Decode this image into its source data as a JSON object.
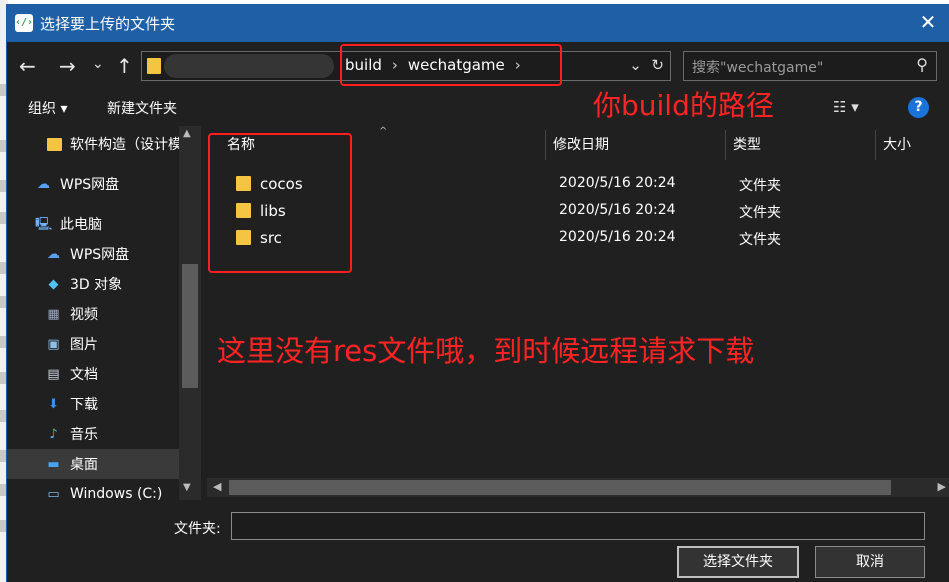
{
  "window": {
    "title": "选择要上传的文件夹",
    "close_glyph": "✕"
  },
  "nav": {
    "back_glyph": "←",
    "forward_glyph": "→",
    "recent_glyph": "⌄",
    "up_glyph": "↑"
  },
  "address": {
    "crumbs": [
      "build",
      "wechatgame"
    ],
    "sep": "›",
    "dropdown_glyph": "⌄",
    "refresh_glyph": "↻"
  },
  "search": {
    "placeholder": "搜索\"wechatgame\"",
    "icon": "search-icon"
  },
  "toolbar": {
    "organize": "组织 ▾",
    "new_folder": "新建文件夹",
    "view_glyph": "☷ ▾",
    "help_glyph": "?"
  },
  "sidebar": {
    "items": [
      {
        "label": "软件构造（设计模",
        "icon": "folder-icon"
      },
      {
        "label": "WPS网盘",
        "icon": "cloud-icon"
      },
      {
        "label": "此电脑",
        "icon": "computer-icon"
      },
      {
        "label": "WPS网盘",
        "icon": "cloud-icon"
      },
      {
        "label": "3D 对象",
        "icon": "cube-icon"
      },
      {
        "label": "视频",
        "icon": "video-icon"
      },
      {
        "label": "图片",
        "icon": "picture-icon"
      },
      {
        "label": "文档",
        "icon": "document-icon"
      },
      {
        "label": "下载",
        "icon": "download-icon"
      },
      {
        "label": "音乐",
        "icon": "music-icon"
      },
      {
        "label": "桌面",
        "icon": "desktop-icon"
      },
      {
        "label": "Windows (C:)",
        "icon": "drive-icon"
      }
    ]
  },
  "filelist": {
    "columns": [
      "名称",
      "修改日期",
      "类型",
      "大小"
    ],
    "rows": [
      {
        "name": "cocos",
        "date": "2020/5/16 20:24",
        "type": "文件夹"
      },
      {
        "name": "libs",
        "date": "2020/5/16 20:24",
        "type": "文件夹"
      },
      {
        "name": "src",
        "date": "2020/5/16 20:24",
        "type": "文件夹"
      }
    ]
  },
  "footer": {
    "folder_label": "文件夹:",
    "folder_value": "",
    "select_button": "选择文件夹",
    "cancel_button": "取消"
  },
  "annotations": {
    "path_note": "你build的路径",
    "res_note": "这里没有res文件哦，到时候远程请求下载",
    "color": "#ff1f1f"
  },
  "colors": {
    "titlebar": "#1f5fa6",
    "background": "#202020",
    "folder": "#f4c542"
  }
}
